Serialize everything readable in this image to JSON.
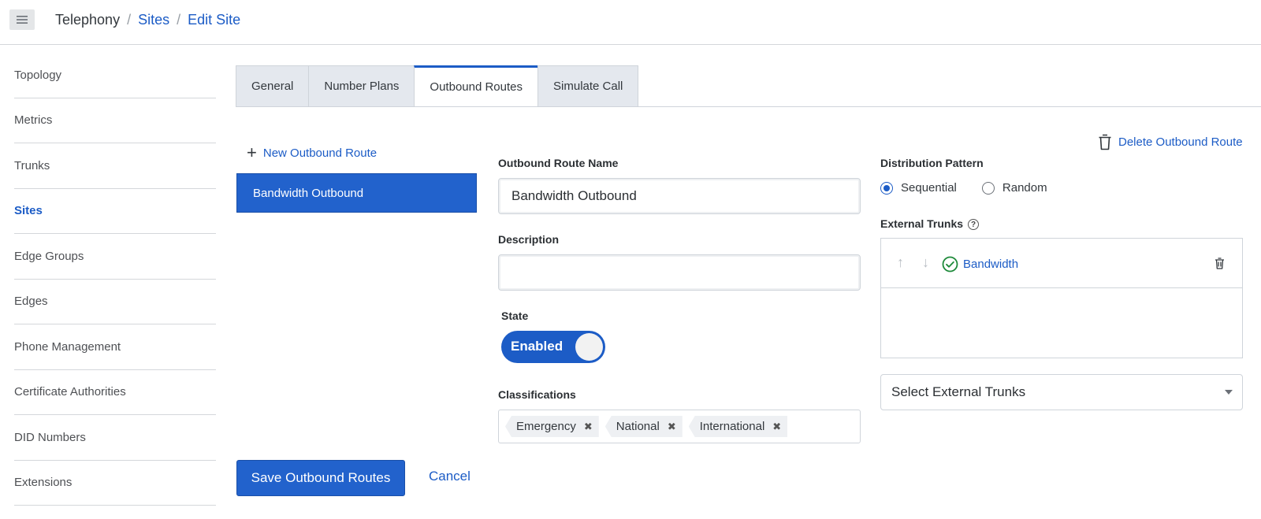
{
  "header": {
    "breadcrumb": [
      "Telephony",
      "Sites",
      "Edit Site"
    ]
  },
  "sidebar": {
    "items": [
      {
        "label": "Topology",
        "active": false
      },
      {
        "label": "Metrics",
        "active": false
      },
      {
        "label": "Trunks",
        "active": false
      },
      {
        "label": "Sites",
        "active": true
      },
      {
        "label": "Edge Groups",
        "active": false
      },
      {
        "label": "Edges",
        "active": false
      },
      {
        "label": "Phone Management",
        "active": false
      },
      {
        "label": "Certificate Authorities",
        "active": false
      },
      {
        "label": "DID Numbers",
        "active": false
      },
      {
        "label": "Extensions",
        "active": false
      }
    ]
  },
  "tabs": [
    {
      "label": "General",
      "active": false
    },
    {
      "label": "Number Plans",
      "active": false
    },
    {
      "label": "Outbound Routes",
      "active": true
    },
    {
      "label": "Simulate Call",
      "active": false
    }
  ],
  "routes": {
    "new_label": "New Outbound Route",
    "items": [
      "Bandwidth Outbound"
    ]
  },
  "form": {
    "name_label": "Outbound Route Name",
    "name_value": "Bandwidth Outbound",
    "description_label": "Description",
    "description_value": "",
    "state_label": "State",
    "state_value": "Enabled",
    "classifications_label": "Classifications",
    "classifications": [
      "Emergency",
      "National",
      "International"
    ],
    "save_label": "Save Outbound Routes",
    "cancel_label": "Cancel"
  },
  "right": {
    "delete_label": "Delete Outbound Route",
    "distribution_label": "Distribution Pattern",
    "distribution_options": [
      "Sequential",
      "Random"
    ],
    "distribution_selected": "Sequential",
    "trunks_label": "External Trunks",
    "trunks": [
      "Bandwidth"
    ],
    "select_placeholder": "Select External Trunks"
  },
  "colors": {
    "accent": "#1c5cc6",
    "primary_button": "#2262cc",
    "success": "#1e8a3a"
  }
}
